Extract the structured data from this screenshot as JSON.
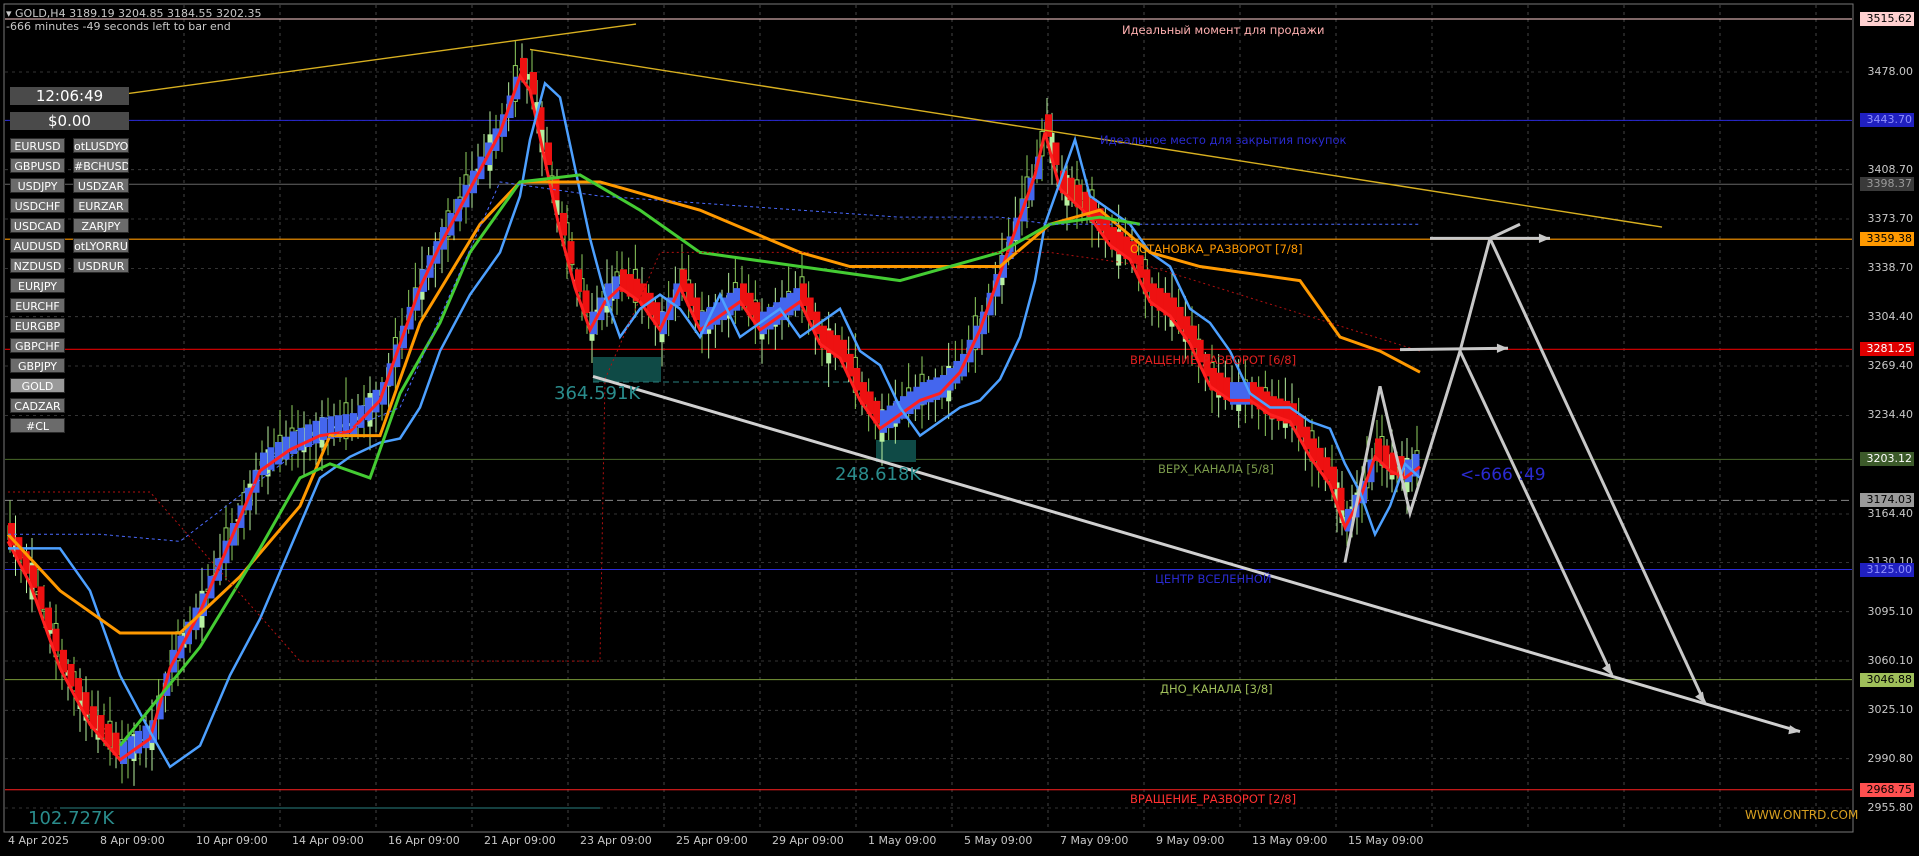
{
  "header": {
    "symbol_line": "GOLD,H4  3189.19 3204.85 3184.55 3202.35",
    "countdown": "-666 minutes -49 seconds left to bar end"
  },
  "panel": {
    "clock": "12:06:49",
    "balance": "$0.00",
    "symbols_left": [
      "EURUSD",
      "GBPUSD",
      "USDJPY",
      "USDCHF",
      "USDCAD",
      "AUDUSD",
      "NZDUSD",
      "EURJPY",
      "EURCHF",
      "EURGBP",
      "GBPCHF",
      "GBPJPY",
      "GOLD",
      "CADZAR",
      "#CL"
    ],
    "symbols_right": [
      "otLUSDYO",
      "#BCHUSD",
      "USDZAR",
      "EURZAR",
      "ZARJPY",
      "otLYORRU",
      "USDRUR"
    ],
    "active_symbol": "GOLD"
  },
  "annotations": {
    "sell_moment": "Идеальный момент для продажи",
    "close_buys": "Идеальное место для закрытия покупок",
    "stop_reversal": "ОСТАНОВКА_РАЗВОРОТ [7/8]",
    "rotation_68": "ВРАЩЕНИЕ_РАЗВОРОТ [6/8]",
    "channel_top": "ВЕРХ_КАНАЛА [5/8]",
    "center": "ЦЕНТР ВСЕЛЕННОЙ",
    "channel_bottom": "ДНО_КАНАЛА [3/8]",
    "rotation_28": "ВРАЩЕНИЕ_РАЗВОРОТ [2/8]",
    "countdown_arrow": "<-666 :49",
    "watermark": "WWW.ONTRD.COM"
  },
  "volumes": [
    "364.591K",
    "248.618K",
    "102.727K"
  ],
  "price_axis": [
    "3478.00",
    "3443.70",
    "3408.70",
    "3373.70",
    "3338.70",
    "3304.40",
    "3269.40",
    "3234.40",
    "3164.40",
    "3130.10",
    "3095.10",
    "3060.10",
    "3025.10",
    "2990.80",
    "2955.80"
  ],
  "price_labels": [
    {
      "value": "3515.62",
      "bg": "#ffd0d0",
      "fg": "#000000"
    },
    {
      "value": "3443.70",
      "bg": "#2020c0",
      "fg": "#9090ff"
    },
    {
      "value": "3398.37",
      "bg": "#3a3a3a",
      "fg": "#9a9a9a"
    },
    {
      "value": "3359.38",
      "bg": "#ff9900",
      "fg": "#000000"
    },
    {
      "value": "3281.25",
      "bg": "#e00000",
      "fg": "#ffffff"
    },
    {
      "value": "3203.12",
      "bg": "#3c5a2a",
      "fg": "#ffffff"
    },
    {
      "value": "3174.03",
      "bg": "#9a9a9a",
      "fg": "#000000"
    },
    {
      "value": "3125.00",
      "bg": "#2020c0",
      "fg": "#9090ff"
    },
    {
      "value": "3046.88",
      "bg": "#9fbf5a",
      "fg": "#000000"
    },
    {
      "value": "2968.75",
      "bg": "#ff5050",
      "fg": "#000000"
    }
  ],
  "time_axis": [
    "4 Apr 2025",
    "8 Apr 09:00",
    "10 Apr 09:00",
    "14 Apr 09:00",
    "16 Apr 09:00",
    "21 Apr 09:00",
    "23 Apr 09:00",
    "25 Apr 09:00",
    "29 Apr 09:00",
    "1 May 09:00",
    "5 May 09:00",
    "7 May 09:00",
    "9 May 09:00",
    "13 May 09:00",
    "15 May 09:00"
  ],
  "colors": {
    "bull_candle": "#b8f0a0",
    "bear_candle": "#90d060",
    "bull_body": "#4466ee",
    "bear_body": "#ee1111",
    "trend_line": "#d8b020",
    "orange_line": "#ff9900",
    "green_line": "#44cc33",
    "arrows": "#c8c8c8"
  }
}
